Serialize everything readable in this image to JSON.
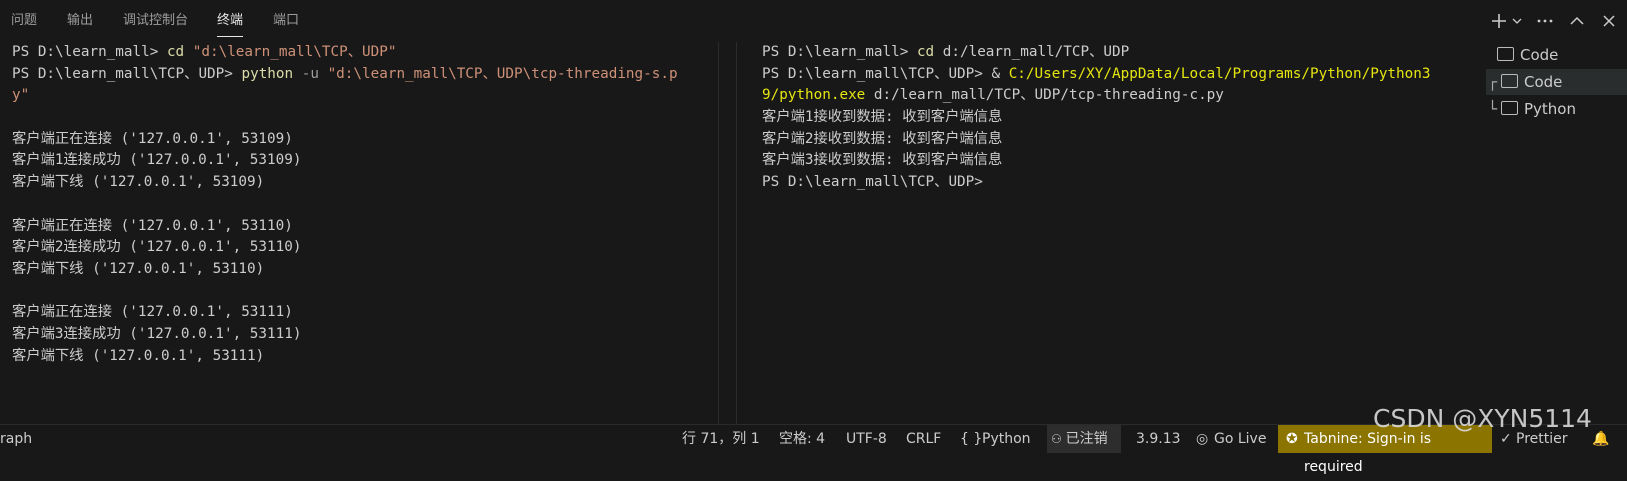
{
  "panel_tabs": [
    "问题",
    "输出",
    "调试控制台",
    "终端",
    "端口"
  ],
  "active_tab": "终端",
  "terminal_left": {
    "line1": {
      "prompt": "PS D:\\learn_mall> ",
      "cmd": "cd",
      "arg": " \"d:\\learn_mall\\TCP、UDP\""
    },
    "line2": {
      "prompt": "PS D:\\learn_mall\\TCP、UDP> ",
      "cmd": "python",
      "flag": " -u ",
      "arg": "\"d:\\learn_mall\\TCP、UDP\\tcp-threading-s.p"
    },
    "line2_wrap": "y\"",
    "output": [
      "",
      "客户端正在连接 ('127.0.0.1', 53109)",
      "客户端1连接成功 ('127.0.0.1', 53109)",
      "客户端下线 ('127.0.0.1', 53109)",
      "",
      "客户端正在连接 ('127.0.0.1', 53110)",
      "客户端2连接成功 ('127.0.0.1', 53110)",
      "客户端下线 ('127.0.0.1', 53110)",
      "",
      "客户端正在连接 ('127.0.0.1', 53111)",
      "客户端3连接成功 ('127.0.0.1', 53111)",
      "客户端下线 ('127.0.0.1', 53111)"
    ]
  },
  "terminal_right": {
    "line1": {
      "prompt": "PS D:\\learn_mall> ",
      "cmd": "cd",
      "arg": " d:/learn_mall/TCP、UDP"
    },
    "line2": {
      "prompt": "PS D:\\learn_mall\\TCP、UDP> ",
      "amp": "& ",
      "exe": "C:/Users/XY/AppData/Local/Programs/Python/Python3"
    },
    "line3": {
      "exe": "9/python.exe",
      "arg": " d:/learn_mall/TCP、UDP/tcp-threading-c.py"
    },
    "output": [
      "客户端1接收到数据: 收到客户端信息",
      "客户端2接收到数据: 收到客户端信息",
      "客户端3接收到数据: 收到客户端信息",
      "PS D:\\learn_mall\\TCP、UDP>"
    ]
  },
  "terminal_list": [
    {
      "label": "Code",
      "tree": ""
    },
    {
      "label": "Code",
      "tree": "┌"
    },
    {
      "label": "Python",
      "tree": "└"
    }
  ],
  "status_bar": {
    "left": "raph",
    "position": "行 71，列 1",
    "spaces": "空格: 4",
    "encoding": "UTF-8",
    "eol": "CRLF",
    "language": "Python",
    "account": "已注销",
    "python_version": "3.9.13",
    "go_live": "Go Live",
    "tabnine": "Tabnine: Sign-in is required",
    "prettier": "Prettier"
  },
  "watermark": "CSDN @XYN5114",
  "colors": {
    "cmd": "#dcdcaa",
    "string": "#ce9178",
    "flag": "#9d9d9d",
    "exe": "#e5e510",
    "tabnine_bg": "#8b7400"
  }
}
